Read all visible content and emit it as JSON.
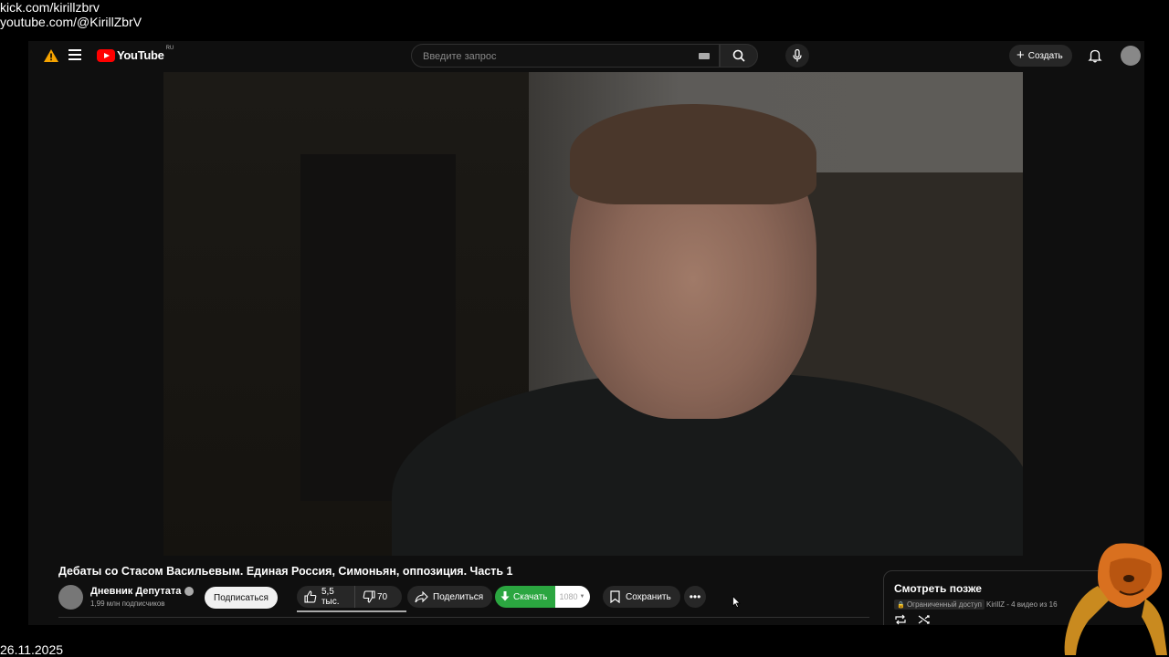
{
  "overlay": {
    "line1": "kick.com/kirillzbrv",
    "line2": "youtube.com/@KirillZbrV",
    "date": "26.11.2025"
  },
  "header": {
    "logo_text": "YouTube",
    "logo_region": "RU",
    "search_placeholder": "Введите запрос",
    "create_label": "Создать",
    "icons": [
      "warning-icon",
      "menu-icon",
      "keyboard-icon",
      "search-icon",
      "mic-icon",
      "plus-icon",
      "bell-icon"
    ]
  },
  "video": {
    "title": "Дебаты со Стасом Васильевым. Единая Россия, Симоньян, оппозиция. Часть 1",
    "channel_name": "Дневник Депутата",
    "subscribers": "1,99 млн подписчиков",
    "subscribe_label": "Подписаться",
    "likes": "5,5 тыс.",
    "dislikes": "70",
    "share_label": "Поделиться",
    "download_label": "Скачать",
    "quality": "1080",
    "save_label": "Сохранить"
  },
  "playlist": {
    "title": "Смотреть позже",
    "access": "Ограниченный доступ",
    "owner_info": "KirillZ - 4 видео из 16"
  },
  "colors": {
    "background": "#0f0f0f",
    "brand_red": "#ff0000",
    "download_green": "#2ba640",
    "chip": "#272727"
  }
}
